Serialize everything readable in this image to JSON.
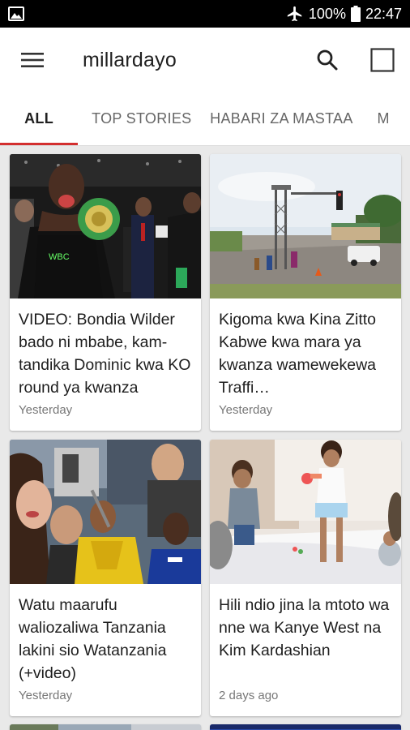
{
  "status_bar": {
    "battery": "100%",
    "time": "22:47"
  },
  "app_bar": {
    "title": "millardayo"
  },
  "tabs": [
    {
      "label": "ALL",
      "active": true
    },
    {
      "label": "TOP STORIES",
      "active": false
    },
    {
      "label": "HABARI ZA MASTAA",
      "active": false
    },
    {
      "label": "M",
      "active": false
    }
  ],
  "articles": [
    {
      "headline": "VIDEO: Bondia Wilder bado ni mbabe, kam-tandika Dominic kwa KO round ya kwanza",
      "time": "Yesterday"
    },
    {
      "headline": "Kigoma kwa Kina Zitto Kabwe kwa mara ya kwanza wamewekewa Traffi…",
      "time": "Yesterday"
    },
    {
      "headline": "Watu maarufu waliozaliwa Tanzania lakini sio Watanzania (+video)",
      "time": "Yesterday"
    },
    {
      "headline": "Hili ndio jina la mtoto wa nne wa Kanye West na Kim Kardashian",
      "time": "2 days ago"
    }
  ],
  "colors": {
    "accent": "#d32f2f",
    "background": "#e9e9e9"
  }
}
